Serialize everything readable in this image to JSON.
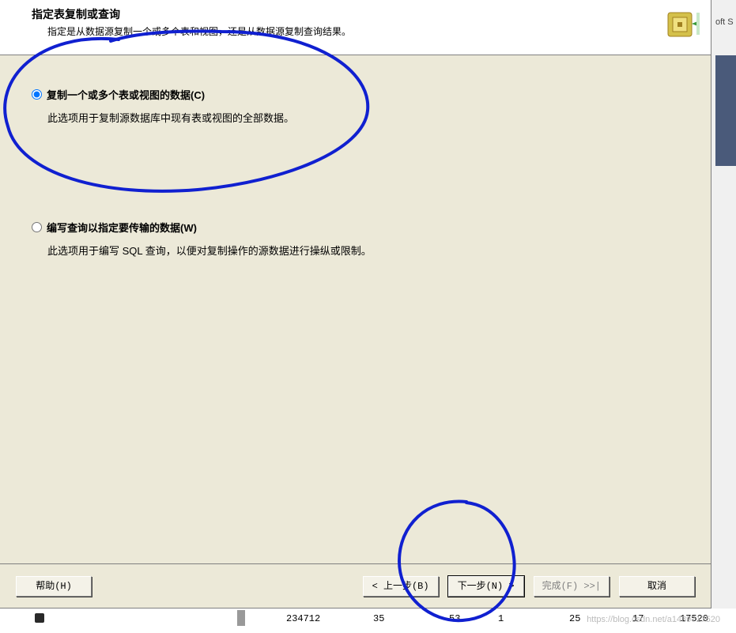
{
  "header": {
    "title": "指定表复制或查询",
    "subtitle": "指定是从数据源复制一个或多个表和视图，还是从数据源复制查询结果。"
  },
  "options": {
    "copy": {
      "label": "复制一个或多个表或视图的数据(C)",
      "desc": "此选项用于复制源数据库中现有表或视图的全部数据。",
      "checked": true
    },
    "query": {
      "label": "编写查询以指定要传输的数据(W)",
      "desc": "此选项用于编写 SQL 查询，以便对复制操作的源数据进行操纵或限制。",
      "checked": false
    }
  },
  "buttons": {
    "help": "帮助(H)",
    "back": "< 上一步(B)",
    "next": "下一步(N) >",
    "finish": "完成(F) >>|",
    "cancel": "取消"
  },
  "background": {
    "corner_text": "oft S"
  },
  "status_row": {
    "col1": "234712",
    "col2": "35",
    "col3": "53",
    "col4": "1",
    "col5": "25",
    "col6": "17",
    "col7": "17520"
  },
  "watermark": "https://blog.csdn.net/a1439717520"
}
